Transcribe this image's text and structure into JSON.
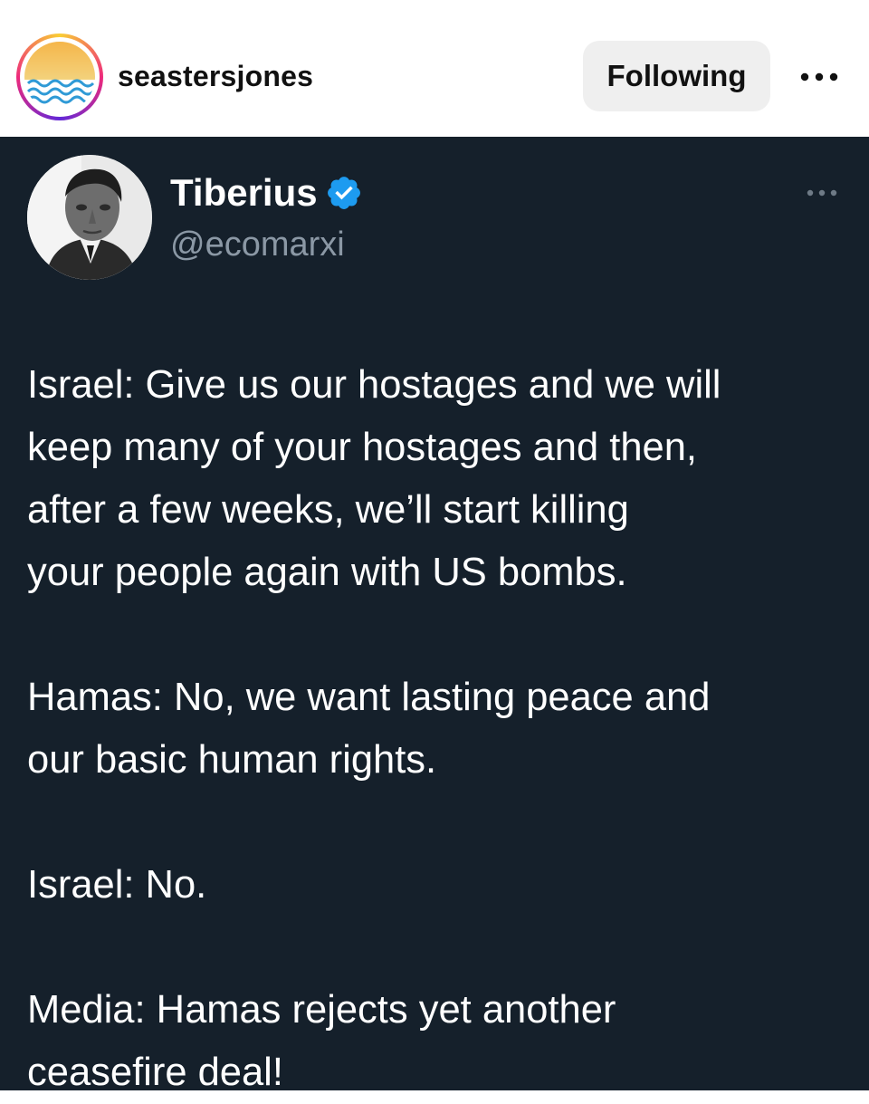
{
  "instagram_header": {
    "username": "seastersjones",
    "follow_button": "Following",
    "more_icon": "more-horizontal-icon",
    "avatar": "seastersjones-logo"
  },
  "tweet": {
    "display_name": "Tiberius",
    "handle": "@ecomarxi",
    "verified": true,
    "badge_color": "#1d9bf0",
    "background_color": "#15202b",
    "more_icon": "more-horizontal-icon",
    "paragraphs": [
      {
        "lines": [
          "Israel: Give us our hostages and we will",
          "keep many of your hostages and then,",
          "after a few weeks, we’ll start killing",
          "your people again with US bombs."
        ]
      },
      {
        "lines": [
          "Hamas: No, we want lasting peace and",
          "our basic human rights."
        ]
      },
      {
        "lines": [
          "Israel: No."
        ]
      },
      {
        "lines": [
          "Media: Hamas rejects yet another",
          "ceasefire deal!"
        ]
      }
    ]
  }
}
